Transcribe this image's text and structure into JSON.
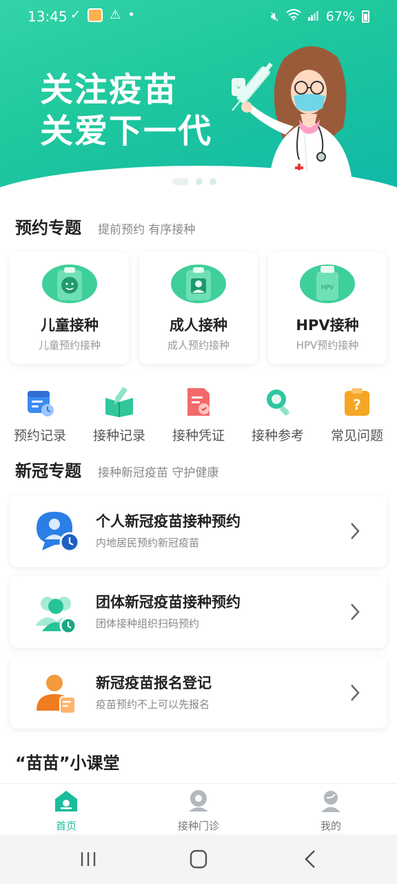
{
  "status_bar": {
    "time": "13:45",
    "battery": "67%"
  },
  "banner": {
    "title_line1": "关注疫苗",
    "title_line2": "关爱下一代"
  },
  "appointments": {
    "heading": "预约专题",
    "subheading": "提前预约 有序接种",
    "cards": [
      {
        "title": "儿童接种",
        "sub": "儿童预约接种",
        "icon": "child-icon"
      },
      {
        "title": "成人接种",
        "sub": "成人预约接种",
        "icon": "adult-icon"
      },
      {
        "title": "HPV接种",
        "sub": "HPV预约接种",
        "icon": "hpv-vial-icon",
        "icon_text": "HPV"
      }
    ]
  },
  "quick_links": [
    {
      "label": "预约记录",
      "icon": "calendar-clock-icon"
    },
    {
      "label": "接种记录",
      "icon": "vaccination-book-icon"
    },
    {
      "label": "接种凭证",
      "icon": "certificate-icon"
    },
    {
      "label": "接种参考",
      "icon": "magnifier-icon"
    },
    {
      "label": "常见问题",
      "icon": "question-clipboard-icon"
    }
  ],
  "covid": {
    "heading": "新冠专题",
    "subheading": "接种新冠疫苗 守护健康",
    "items": [
      {
        "title": "个人新冠疫苗接种预约",
        "sub": "内地居民预约新冠疫苗",
        "icon": "person-chat-clock-icon"
      },
      {
        "title": "团体新冠疫苗接种预约",
        "sub": "团体接种组织扫码预约",
        "icon": "group-clock-icon"
      },
      {
        "title": "新冠疫苗报名登记",
        "sub": "疫苗预约不上可以先报名",
        "icon": "person-register-icon"
      }
    ]
  },
  "classroom": {
    "heading": "“苗苗”小课堂"
  },
  "tabbar": {
    "tabs": [
      {
        "label": "首页",
        "icon": "home-icon",
        "active": true
      },
      {
        "label": "接种门诊",
        "icon": "clinic-pin-icon",
        "active": false
      },
      {
        "label": "我的",
        "icon": "profile-icon",
        "active": false
      }
    ]
  },
  "colors": {
    "primary": "#1abc9c",
    "banner_start": "#34d3a9",
    "banner_end": "#10b7a8"
  }
}
